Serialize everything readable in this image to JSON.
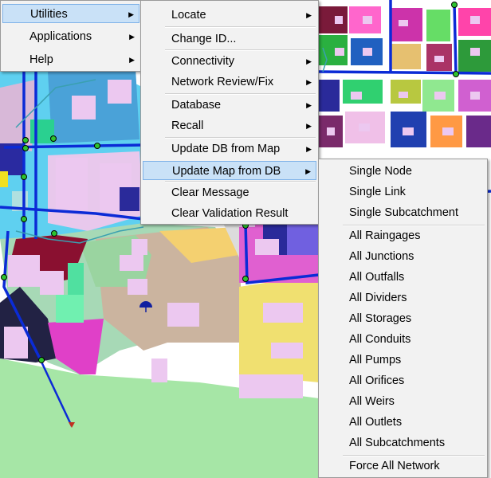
{
  "menu_main": {
    "items": [
      {
        "label": "Utilities",
        "has_submenu": true,
        "highlighted": true
      },
      {
        "label": "Applications",
        "has_submenu": true
      },
      {
        "label": "Help",
        "has_submenu": true
      }
    ]
  },
  "menu_utilities": {
    "items": [
      {
        "label": "Locate",
        "has_submenu": true
      },
      {
        "label": "Change ID..."
      },
      {
        "label": "Connectivity",
        "has_submenu": true
      },
      {
        "label": "Network Review/Fix",
        "has_submenu": true
      },
      {
        "label": "Database",
        "has_submenu": true
      },
      {
        "label": "Recall",
        "has_submenu": true
      },
      {
        "label": "Update DB from Map",
        "has_submenu": true
      },
      {
        "label": "Update Map from DB",
        "has_submenu": true,
        "highlighted": true
      },
      {
        "label": "Clear Message"
      },
      {
        "label": "Clear Validation Result"
      }
    ]
  },
  "menu_update_map_from_db": {
    "items": [
      {
        "label": "Single Node"
      },
      {
        "label": "Single Link"
      },
      {
        "label": "Single Subcatchment"
      },
      {
        "label": "All Raingages"
      },
      {
        "label": "All Junctions"
      },
      {
        "label": "All Outfalls"
      },
      {
        "label": "All Dividers"
      },
      {
        "label": "All Storages"
      },
      {
        "label": "All Conduits"
      },
      {
        "label": "All Pumps"
      },
      {
        "label": "All Orifices"
      },
      {
        "label": "All Weirs"
      },
      {
        "label": "All Outlets"
      },
      {
        "label": "All Subcatchments"
      },
      {
        "label": "Force All Network"
      }
    ]
  },
  "icons": {
    "submenu_arrow": "triangle-right-icon",
    "raingage": "umbrella-icon",
    "outfall": "triangle-down-icon"
  },
  "colors": {
    "menu_bg": "#f2f2f2",
    "highlight": "#c9e1f7",
    "highlight_border": "#7fb2e8",
    "pipe": "#0b2bd6",
    "node": "#2ec22e"
  }
}
